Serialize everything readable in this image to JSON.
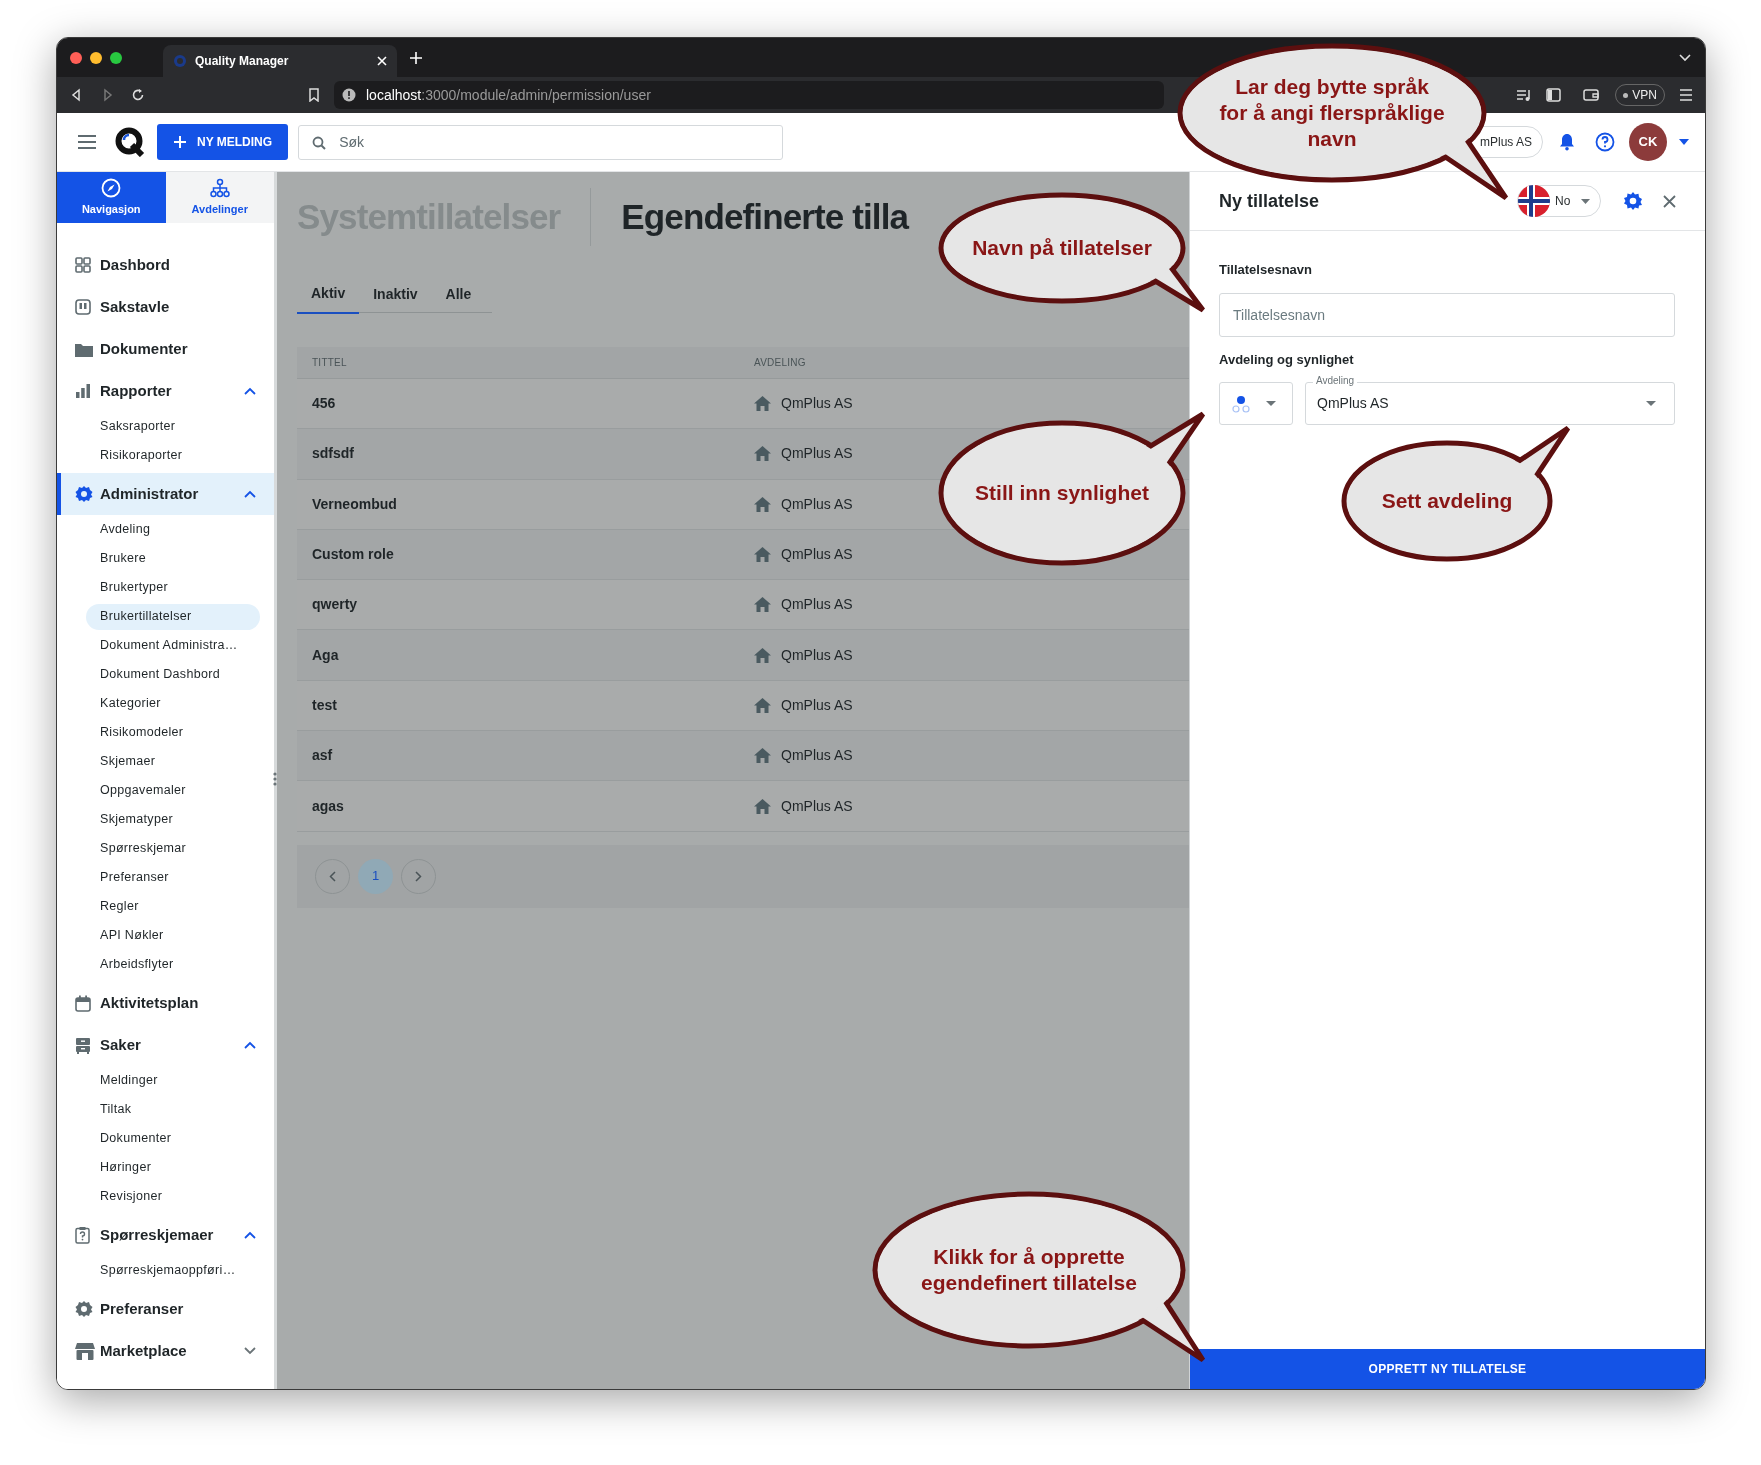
{
  "browser": {
    "tab_title": "Quality Manager",
    "url_host": "localhost",
    "url_path": ":3000/module/admin/permission/user",
    "vpn": "VPN"
  },
  "header": {
    "new_button": "NY MELDING",
    "search": {
      "placeholder": "Søk"
    },
    "org": "mPlus AS",
    "avatar": "CK"
  },
  "sidebar": {
    "tabs": [
      {
        "label": "Navigasjon",
        "selected": true
      },
      {
        "label": "Avdelinger",
        "selected": false
      }
    ],
    "items": [
      {
        "kind": "link",
        "label": "Dashbord",
        "selected": false
      },
      {
        "kind": "link",
        "label": "Sakstavle",
        "selected": false
      },
      {
        "kind": "link",
        "label": "Dokumenter",
        "selected": false
      },
      {
        "kind": "group",
        "label": "Rapporter",
        "selected": false,
        "expanded": true,
        "children": [
          {
            "label": "Saksraporter",
            "selected": false
          },
          {
            "label": "Risikoraporter",
            "selected": false
          }
        ]
      },
      {
        "kind": "group",
        "label": "Administrator",
        "selected": true,
        "expanded": true,
        "children": [
          {
            "label": "Avdeling",
            "selected": false
          },
          {
            "label": "Brukere",
            "selected": false
          },
          {
            "label": "Brukertyper",
            "selected": false
          },
          {
            "label": "Brukertillatelser",
            "selected": true
          },
          {
            "label": "Dokument Administra…",
            "selected": false
          },
          {
            "label": "Dokument Dashbord",
            "selected": false
          },
          {
            "label": "Kategorier",
            "selected": false
          },
          {
            "label": "Risikomodeler",
            "selected": false
          },
          {
            "label": "Skjemaer",
            "selected": false
          },
          {
            "label": "Oppgavemaler",
            "selected": false
          },
          {
            "label": "Skjematyper",
            "selected": false
          },
          {
            "label": "Spørreskjemar",
            "selected": false
          },
          {
            "label": "Preferanser",
            "selected": false
          },
          {
            "label": "Regler",
            "selected": false
          },
          {
            "label": "API Nøkler",
            "selected": false
          },
          {
            "label": "Arbeidsflyter",
            "selected": false
          }
        ]
      },
      {
        "kind": "link",
        "label": "Aktivitetsplan",
        "selected": false
      },
      {
        "kind": "group",
        "label": "Saker",
        "selected": false,
        "expanded": true,
        "children": [
          {
            "label": "Meldinger",
            "selected": false
          },
          {
            "label": "Tiltak",
            "selected": false
          },
          {
            "label": "Dokumenter",
            "selected": false
          },
          {
            "label": "Høringer",
            "selected": false
          },
          {
            "label": "Revisjoner",
            "selected": false
          }
        ]
      },
      {
        "kind": "group",
        "label": "Spørreskjemaer",
        "selected": false,
        "expanded": true,
        "children": [
          {
            "label": "Spørreskjemaoppføri…",
            "selected": false
          }
        ]
      },
      {
        "kind": "link",
        "label": "Preferanser",
        "selected": false
      },
      {
        "kind": "group",
        "label": "Marketplace",
        "selected": false,
        "expanded": false
      }
    ]
  },
  "main": {
    "titles": [
      {
        "label": "Systemtillatelser",
        "selected": false
      },
      {
        "label": "Egendefinerte tilla",
        "selected": true
      }
    ],
    "tabs": [
      {
        "label": "Aktiv",
        "selected": true
      },
      {
        "label": "Inaktiv",
        "selected": false
      },
      {
        "label": "Alle",
        "selected": false
      }
    ],
    "table": {
      "columns": [
        "TITTEL",
        "AVDELING"
      ],
      "rows": [
        {
          "title": "456",
          "department": "QmPlus AS"
        },
        {
          "title": "sdfsdf",
          "department": "QmPlus AS"
        },
        {
          "title": "Verneombud",
          "department": "QmPlus AS"
        },
        {
          "title": "Custom role",
          "department": "QmPlus AS"
        },
        {
          "title": "qwerty",
          "department": "QmPlus AS"
        },
        {
          "title": "Aga",
          "department": "QmPlus AS"
        },
        {
          "title": "test",
          "department": "QmPlus AS"
        },
        {
          "title": "asf",
          "department": "QmPlus AS"
        },
        {
          "title": "agas",
          "department": "QmPlus AS"
        }
      ]
    },
    "pages": [
      {
        "label": "1",
        "selected": true
      }
    ]
  },
  "panel": {
    "title": "Ny tillatelse",
    "language": "No",
    "name_label": "Tillatelsesnavn",
    "name_field": {
      "placeholder": "Tillatelsesnavn"
    },
    "section_label": "Avdeling og synlighet",
    "department": {
      "label": "Avdeling",
      "value": "QmPlus AS"
    },
    "submit": "OPPRETT NY TILLATELSE"
  },
  "callouts": [
    {
      "text": "Lar deg bytte språk\nfor å angi flerspråklige\nnavn"
    },
    {
      "text": "Navn på tillatelser"
    },
    {
      "text": "Still inn synlighet"
    },
    {
      "text": "Sett avdeling"
    },
    {
      "text": "Klikk for å opprette\negendefinert tillatelse"
    }
  ]
}
